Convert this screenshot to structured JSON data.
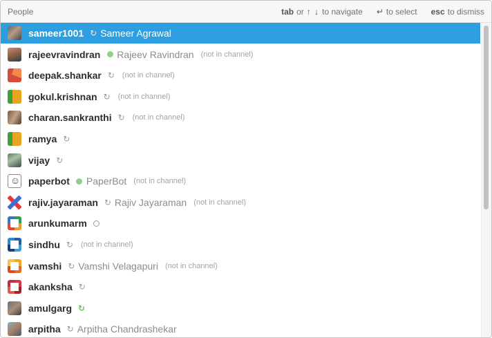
{
  "header": {
    "title": "People",
    "hint_tab_key": "tab",
    "hint_or": "or",
    "hint_arrows": "↑ ↓",
    "hint_navigate": "to navigate",
    "hint_enter_glyph": "↵",
    "hint_select": "to select",
    "hint_esc_key": "esc",
    "hint_dismiss": "to dismiss"
  },
  "people": [
    {
      "username": "sameer1001",
      "status": "away-clock",
      "real_name": "Sameer Agrawal",
      "note": "",
      "avatar": "photo1",
      "selected": true
    },
    {
      "username": "rajeevravindran",
      "status": "active",
      "real_name": "Rajeev Ravindran",
      "note": "(not in channel)",
      "avatar": "photo2"
    },
    {
      "username": "deepak.shankar",
      "status": "away-clock",
      "real_name": "",
      "note": "(not in channel)",
      "avatar": "red"
    },
    {
      "username": "gokul.krishnan",
      "status": "away-clock",
      "real_name": "",
      "note": "(not in channel)",
      "avatar": "greenorange"
    },
    {
      "username": "charan.sankranthi",
      "status": "away-clock",
      "real_name": "",
      "note": "(not in channel)",
      "avatar": "photo3"
    },
    {
      "username": "ramya",
      "status": "away-clock",
      "real_name": "",
      "note": "",
      "avatar": "greenorange"
    },
    {
      "username": "vijay",
      "status": "away-clock",
      "real_name": "",
      "note": "",
      "avatar": "photo4"
    },
    {
      "username": "paperbot",
      "status": "active",
      "real_name": "PaperBot",
      "note": "(not in channel)",
      "avatar": "bot"
    },
    {
      "username": "rajiv.jayaraman",
      "status": "away-clock",
      "real_name": "Rajiv Jayaraman",
      "note": "(not in channel)",
      "avatar": "cross"
    },
    {
      "username": "arunkumarm",
      "status": "away-ring",
      "real_name": "",
      "note": "",
      "avatar": "quad-green"
    },
    {
      "username": "sindhu",
      "status": "away-clock",
      "real_name": "",
      "note": "(not in channel)",
      "avatar": "quad-blue"
    },
    {
      "username": "vamshi",
      "status": "away-clock",
      "real_name": "Vamshi Velagapuri",
      "note": "(not in channel)",
      "avatar": "quad-orange"
    },
    {
      "username": "akanksha",
      "status": "away-clock",
      "real_name": "",
      "note": "",
      "avatar": "quad-red"
    },
    {
      "username": "amulgarg",
      "status": "active-clock",
      "real_name": "",
      "note": "",
      "avatar": "photo5"
    },
    {
      "username": "arpitha",
      "status": "away-clock",
      "real_name": "Arpitha Chandrashekar",
      "note": "",
      "avatar": "photo6"
    }
  ],
  "scrollbar": {
    "scroll_fraction": 0.0
  }
}
